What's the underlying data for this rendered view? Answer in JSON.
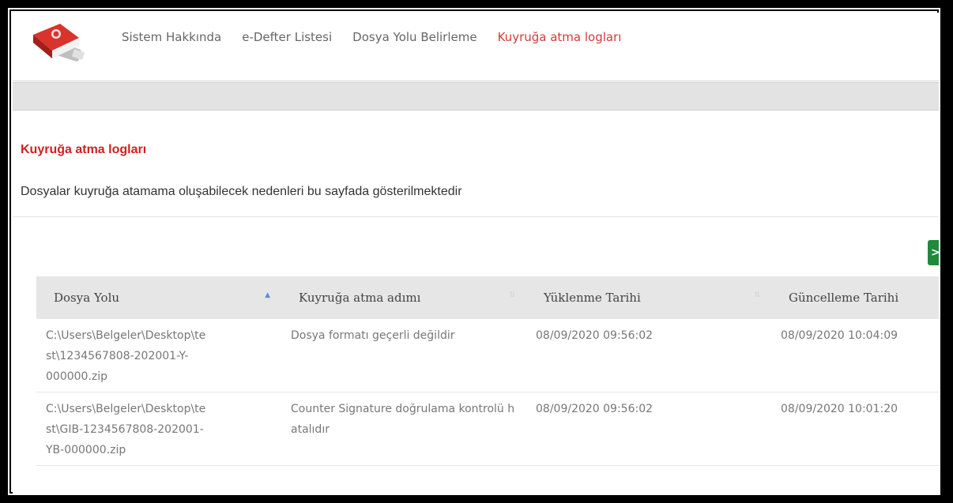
{
  "nav": {
    "items": [
      {
        "label": "Sistem Hakkında"
      },
      {
        "label": "e-Defter Listesi"
      },
      {
        "label": "Dosya Yolu Belirleme"
      },
      {
        "label": "Kuyruğa atma logları"
      }
    ],
    "active_index": 3,
    "logo_icon": "book-usb-logo-icon",
    "accent_color": "#d11f1f"
  },
  "page": {
    "title": "Kuyruğa atma logları",
    "description": "Dosyalar kuyruğa atamama oluşabilecek nedenleri bu sayfada gösterilmektedir"
  },
  "toolbar": {
    "export_icon": "excel-icon",
    "export_label": ">"
  },
  "table": {
    "columns": [
      {
        "label": "Dosya Yolu",
        "sort": "asc"
      },
      {
        "label": "Kuyruğa atma adımı",
        "sort": "none"
      },
      {
        "label": "Yüklenme Tarihi",
        "sort": "none"
      },
      {
        "label": "Güncelleme Tarihi",
        "sort": "none"
      }
    ],
    "rows": [
      {
        "path": "C:\\Users\\Belgeler\\Desktop\\te\nst\\1234567808-202001-Y-\n000000.zip",
        "step": "Dosya formatı geçerli değildir",
        "uploaded": "08/09/2020 09:56:02",
        "updated": "08/09/2020 10:04:09"
      },
      {
        "path": "C:\\Users\\Belgeler\\Desktop\\te\nst\\GIB-1234567808-202001-\nYB-000000.zip",
        "step": "Counter Signature doğrulama kontrolü hatalıdır",
        "uploaded": "08/09/2020 09:56:02",
        "updated": "08/09/2020 10:01:20"
      }
    ]
  }
}
